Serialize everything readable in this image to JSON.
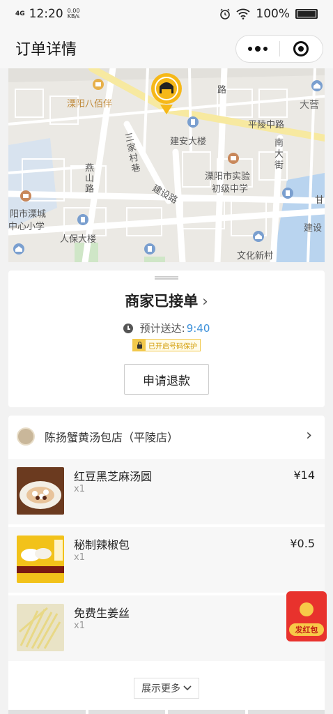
{
  "status_bar": {
    "network": "4G",
    "time": "12:20",
    "speed_value": "0.00",
    "speed_unit": "KB/s",
    "battery": "100%"
  },
  "nav": {
    "title": "订单详情"
  },
  "map": {
    "labels": {
      "bapai": "溧阳八佰伴",
      "jianan": "建安大楼",
      "pinglingzhonglu": "平陵中路",
      "dayingxiang": "大营",
      "nandajie": "南大街",
      "sanjiacun": "三家村巷",
      "yanshanlu": "燕山路",
      "jianshelu": "建设路",
      "school_1": "溧阳市实验",
      "school_2": "初级中学",
      "licheng_1": "阳市溧城",
      "licheng_2": "中心小学",
      "renbao": "人保大楼",
      "wenhua": "文化新村",
      "lu": "路",
      "jianshe_right": "建设",
      "gan": "甘"
    }
  },
  "order": {
    "status": "商家已接单",
    "eta_label": "预计送达:",
    "eta_time": "9:40",
    "privacy": "已开启号码保护",
    "refund_button": "申请退款"
  },
  "store": {
    "name": "陈扬蟹黄汤包店（平陵店）",
    "items": [
      {
        "name": "红豆黑芝麻汤圆",
        "qty": "x1",
        "price": "¥14"
      },
      {
        "name": "秘制辣椒包",
        "qty": "x1",
        "price": "¥0.5"
      },
      {
        "name": "免费生姜丝",
        "qty": "x1",
        "price": ""
      }
    ],
    "show_more": "展示更多"
  },
  "red_packet": {
    "label": "发红包"
  }
}
